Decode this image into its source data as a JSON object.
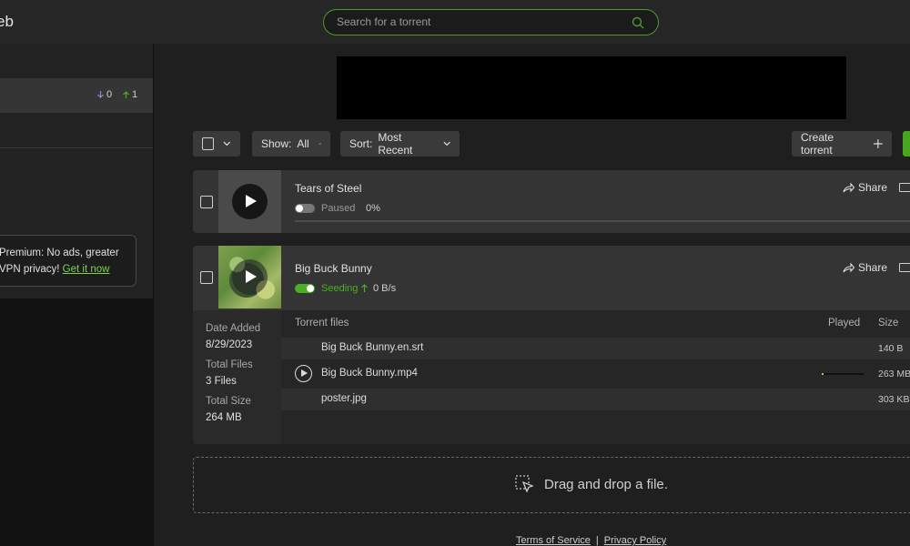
{
  "app": {
    "brand": "eb"
  },
  "search": {
    "placeholder": "Search for a torrent"
  },
  "sidebar": {
    "stats": {
      "down": "0",
      "up": "1"
    },
    "promo": {
      "line1": "Premium: No ads, greater",
      "line2": "VPN privacy!",
      "link": "Get it now"
    }
  },
  "toolbar": {
    "show_label": "Show:",
    "show_value": "All",
    "sort_label": "Sort:",
    "sort_value": "Most Recent",
    "create_label": "Create torrent"
  },
  "torrents": [
    {
      "name": "Tears of Steel",
      "status": "Paused",
      "progress": "0%",
      "share_label": "Share",
      "thumbnail": "play-icon"
    },
    {
      "name": "Big Buck Bunny",
      "status": "Seeding",
      "speed": "0 B/s",
      "share_label": "Share",
      "thumbnail": "big-buck-bunny-thumbnail",
      "details": {
        "date_added_label": "Date Added",
        "date_added": "8/29/2023",
        "total_files_label": "Total Files",
        "total_files": "3 Files",
        "total_size_label": "Total Size",
        "total_size": "264 MB"
      },
      "files_header": {
        "name": "Torrent files",
        "played": "Played",
        "size": "Size"
      },
      "files": [
        {
          "name": "Big Buck Bunny.en.srt",
          "size": "140 B"
        },
        {
          "name": "Big Buck Bunny.mp4",
          "size": "263 MB",
          "played_fraction": 0.05
        },
        {
          "name": "poster.jpg",
          "size": "303 KB"
        }
      ]
    }
  ],
  "dropzone": {
    "text": "Drag and drop a file."
  },
  "footer": {
    "terms": "Terms of Service",
    "separator": "|",
    "privacy": "Privacy Policy"
  },
  "colors": {
    "accent": "#4cae22",
    "search_border": "#4c9a2a",
    "background": "#1f1f1f"
  }
}
